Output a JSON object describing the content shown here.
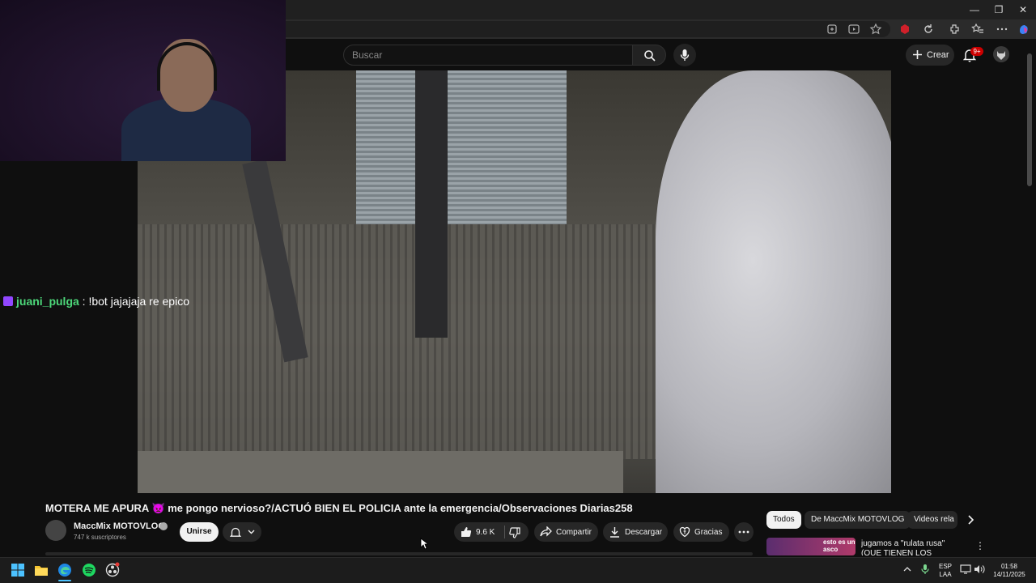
{
  "browser": {
    "window_controls": [
      "—",
      "❐",
      "✕"
    ]
  },
  "youtube": {
    "search_placeholder": "Buscar",
    "create_label": "Crear",
    "notification_count": "9+"
  },
  "overlay": {
    "chat_user": "juani_pulga",
    "chat_message": " : !bot jajajaja re epico"
  },
  "video": {
    "title": "MOTERA ME APURA 👿 me pongo nervioso?/ACTUÓ BIEN EL POLICIA ante la emergencia/Observaciones Diarias258",
    "channel_name": "MaccMix MOTOVLOG",
    "subscribers": "747 k suscriptores",
    "join_label": "Unirse",
    "likes": "9.6 K",
    "share_label": "Compartir",
    "download_label": "Descargar",
    "thanks_label": "Gracias"
  },
  "sidebar": {
    "chips": [
      "Todos",
      "De MaccMix MOTOVLOG",
      "Videos rela"
    ],
    "recommendation": {
      "thumb_text": "esto es un asco",
      "title": "jugamos a \"rulata rusa\" (QUE TIENEN LOS VASOS???)"
    }
  },
  "taskbar": {
    "lang_top": "ESP",
    "lang_bottom": "LAA",
    "time": "01:58",
    "date": "14/11/2025"
  },
  "colors": {
    "youtube_bg": "#0f0f0f",
    "chat_username": "#4dd87a",
    "notification_red": "#cc0000"
  }
}
